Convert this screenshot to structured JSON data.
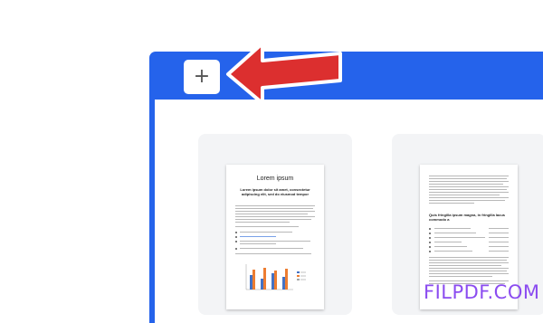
{
  "toolbar": {
    "add_label": "+"
  },
  "documents": [
    {
      "title": "Lorem ipsum",
      "subtitle": "Lorem ipsum dolor sit amet, consectetur adipiscing elit, sed do eiusmod tempor"
    },
    {
      "heading": "Quis fringilla ipsum magna, in fringilla lacus commodo a"
    }
  ],
  "watermark": {
    "text": "FILPDF.COM"
  },
  "colors": {
    "accent": "#2563eb",
    "arrow": "#dc2f2f",
    "watermark": "#8b4cf0"
  }
}
